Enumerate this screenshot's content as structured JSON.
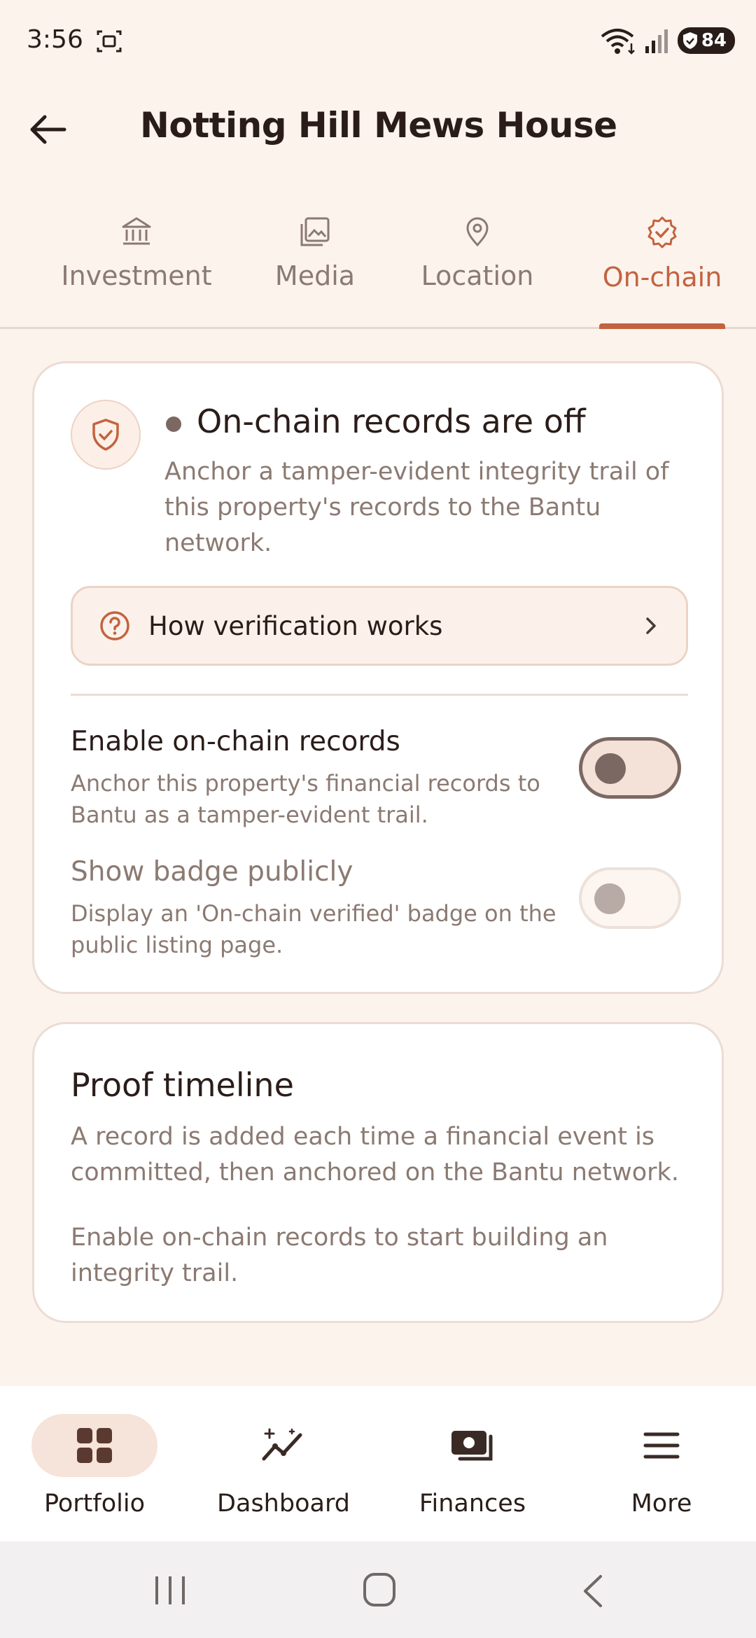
{
  "status_bar": {
    "time": "3:56",
    "battery": "84",
    "icons": [
      "screenshot-icon",
      "wifi-icon",
      "signal-icon",
      "battery-icon"
    ]
  },
  "header": {
    "title": "Notting Hill Mews House",
    "back_icon": "arrow-left-icon"
  },
  "tabs": [
    {
      "label": "Investment",
      "icon": "bank-icon",
      "active": false
    },
    {
      "label": "Media",
      "icon": "gallery-icon",
      "active": false
    },
    {
      "label": "Location",
      "icon": "location-pin-icon",
      "active": false
    },
    {
      "label": "On-chain",
      "icon": "verified-badge-icon",
      "active": true
    }
  ],
  "onchain_card": {
    "status_title": "On-chain records are off",
    "status_desc": "Anchor a tamper-evident integrity trail of this property's records to the Bantu network.",
    "how_label": "How verification works",
    "enable": {
      "label": "Enable on-chain records",
      "desc": "Anchor this property's financial records to Bantu as a tamper-evident trail.",
      "on": false
    },
    "badge": {
      "label": "Show badge publicly",
      "desc": "Display an 'On-chain verified' badge on the public listing page.",
      "on": false
    }
  },
  "proof_card": {
    "title": "Proof timeline",
    "desc": "A record is added each time a financial event is committed, then anchored on the Bantu network.",
    "empty": "Enable on-chain records to start building an integrity trail."
  },
  "bottom_nav": [
    {
      "label": "Portfolio",
      "icon": "grid-icon",
      "active": true
    },
    {
      "label": "Dashboard",
      "icon": "chart-sparkle-icon",
      "active": false
    },
    {
      "label": "Finances",
      "icon": "money-icon",
      "active": false
    },
    {
      "label": "More",
      "icon": "menu-icon",
      "active": false
    }
  ],
  "colors": {
    "background": "#fcf3ed",
    "accent": "#c2633f",
    "text": "#2a1d19",
    "muted": "#8b7a72"
  }
}
